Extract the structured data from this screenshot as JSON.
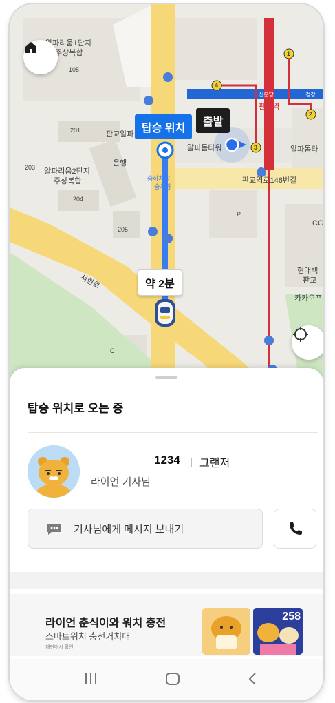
{
  "map": {
    "pickup_tag": "탑승 위치",
    "depart_tag": "출발",
    "eta_tag": "약 2분",
    "labels": {
      "complex1_line1": "알파리움1단지",
      "complex1_line2": "주상복합",
      "complex2_line1": "알파리움2단지",
      "complex2_line2": "주상복합",
      "pangyo_alpha": "판교알파",
      "bank": "은행",
      "alpha_dome": "알파돔타워",
      "alpha_dome_right": "알파돔타",
      "street": "판교역로146번길",
      "pangyo_station": "판교역",
      "shinbundang": "신분당",
      "gyeonggang": "경강",
      "hyundai1": "현대백",
      "hyundai2": "판교",
      "kakao": "카카오프렌",
      "cg": "CG",
      "seohyeon": "서현로",
      "pickup_zone1": "승하차장",
      "pickup_zone2": "승차장",
      "bldg_105": "105",
      "bldg_201": "201",
      "bldg_203": "203",
      "bldg_204": "204",
      "bldg_205": "205",
      "bldg_c": "C",
      "parking": "P",
      "line_1": "1",
      "line_2": "2",
      "line_3": "3",
      "line_4": "4"
    }
  },
  "sheet": {
    "status_title": "탑승 위치로 오는 중",
    "plate": "1234",
    "car_model": "그랜저",
    "driver_name": "라이언 기사님",
    "message_button": "기사님에게 메시지 보내기"
  },
  "ad": {
    "title": "라이언 춘식이와 워치 충전",
    "subtitle": "스마트워치 충전거치대",
    "note": "재판매시 확인",
    "badge": "258"
  },
  "icons": {
    "home": "home-icon",
    "locate": "crosshair-icon",
    "message": "chat-bubble-icon",
    "call": "phone-icon",
    "nav_recent": "recent-apps-icon",
    "nav_home": "nav-home-icon",
    "nav_back": "back-icon"
  },
  "colors": {
    "route_blue": "#3b7df0",
    "pickup_blue": "#1672e8",
    "subway_red": "#d42f3a",
    "subway_blue": "#2367d4",
    "road_yellow": "#f7d879"
  }
}
